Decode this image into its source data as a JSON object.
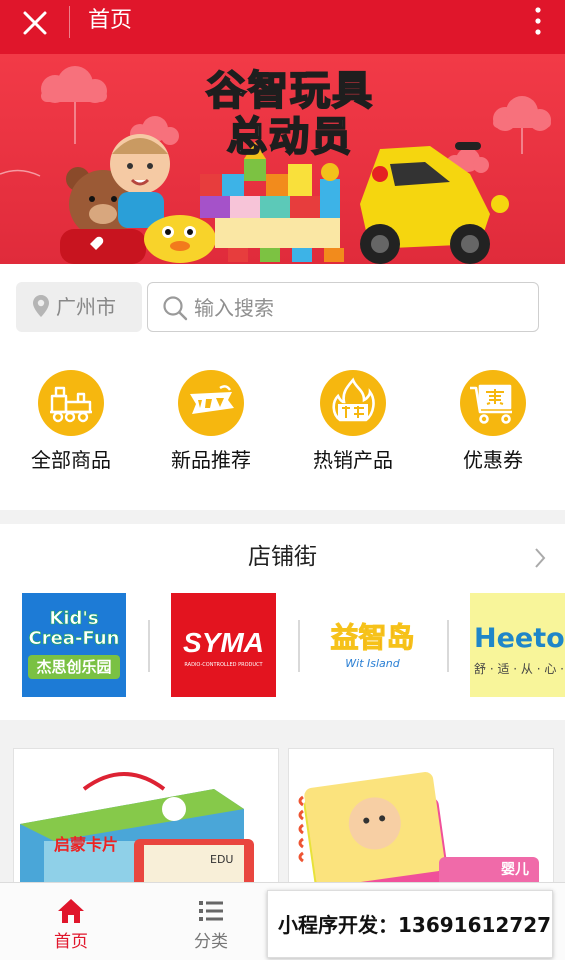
{
  "topbar": {
    "title": "首页",
    "close_icon": "close-icon",
    "more_icon": "more-vertical-icon"
  },
  "banner": {
    "title": "谷智玩具\n总动员"
  },
  "location": {
    "city": "广州市"
  },
  "search": {
    "placeholder": "输入搜索"
  },
  "categories": [
    {
      "label": "全部商品",
      "icon": "train-icon"
    },
    {
      "label": "新品推荐",
      "icon": "new-badge-icon"
    },
    {
      "label": "热销产品",
      "icon": "hot-sale-icon"
    },
    {
      "label": "优惠券",
      "icon": "coupon-cart-icon"
    }
  ],
  "shops": {
    "heading": "店铺街",
    "items": [
      {
        "name": "Kid's Crea-Fun",
        "sub": "杰思创乐园"
      },
      {
        "name": "SYMA",
        "sub": "RADIO-CONTROLLED PRODUCT"
      },
      {
        "name": "益智岛",
        "sub": "Wit Island"
      },
      {
        "name": "Heetoy",
        "sub": "舒 · 适 · 从 · 心 · 开 · 始"
      }
    ]
  },
  "products": [
    {
      "caption": "启蒙卡片",
      "tag": "EDU"
    },
    {
      "caption": "婴儿"
    }
  ],
  "tabbar": {
    "tabs": [
      {
        "label": "首页",
        "icon": "home-icon",
        "active": true
      },
      {
        "label": "分类",
        "icon": "list-icon",
        "active": false
      }
    ],
    "active_color": "#e0162b",
    "inactive_color": "#777777"
  },
  "promo": {
    "text": "小程序开发：13691612727"
  },
  "colors": {
    "brand_red": "#e0162b",
    "category_yellow": "#f6b70f"
  }
}
